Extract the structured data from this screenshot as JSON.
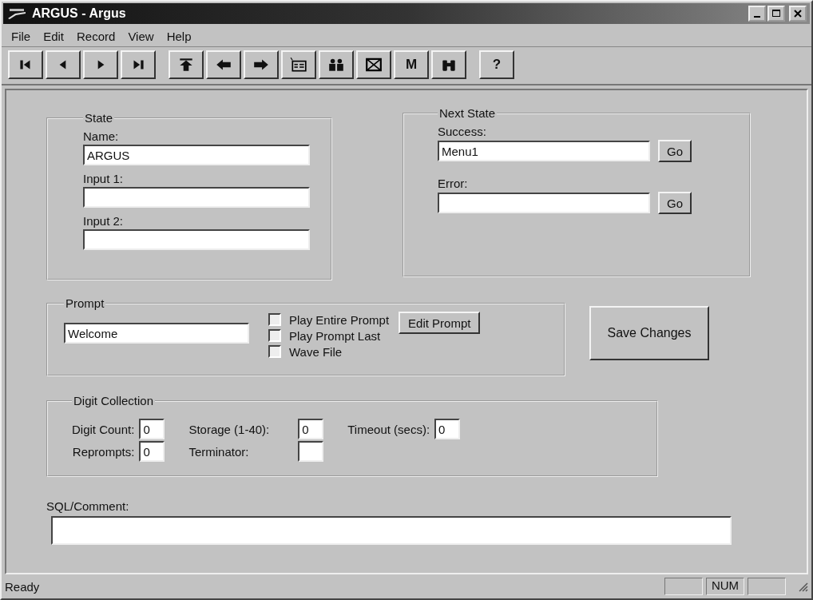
{
  "window": {
    "title": "ARGUS - Argus"
  },
  "menu": [
    "File",
    "Edit",
    "Record",
    "View",
    "Help"
  ],
  "toolbar": [
    [
      {
        "kind": "first"
      },
      {
        "kind": "prev"
      },
      {
        "kind": "next"
      },
      {
        "kind": "last"
      }
    ],
    [
      {
        "kind": "top"
      },
      {
        "kind": "left"
      },
      {
        "kind": "right"
      },
      {
        "kind": "list"
      },
      {
        "kind": "people"
      },
      {
        "kind": "cross"
      },
      {
        "kind": "letter",
        "label": "M"
      },
      {
        "kind": "binoculars"
      }
    ],
    [
      {
        "kind": "letter",
        "label": "?"
      }
    ]
  ],
  "state": {
    "title": "State",
    "fields": [
      {
        "label": "Name:",
        "value": "ARGUS"
      },
      {
        "label": "Input 1:"
      },
      {
        "label": "Input 2:"
      }
    ]
  },
  "next_state": {
    "title": "Next State",
    "fields": [
      {
        "label": "Success:",
        "value": "Menu1",
        "button": "Go"
      },
      {
        "label": "Error:",
        "button": "Go"
      }
    ]
  },
  "prompt": {
    "title": "Prompt",
    "value": "Welcome",
    "checkboxes": [
      {
        "label": "Play Entire Prompt",
        "checked": false
      },
      {
        "label": "Play Prompt Last",
        "checked": false
      },
      {
        "label": "Wave File",
        "checked": false
      }
    ],
    "button": "Edit Prompt"
  },
  "save_button": "Save Changes",
  "digit_collection": {
    "title": "Digit Collection",
    "fields": [
      {
        "label": "Digit Count:",
        "value": "0"
      },
      {
        "label": "Reprompts:",
        "value": "0"
      },
      {
        "label": "Storage (1-40):",
        "value": "0"
      },
      {
        "label": "Terminator:"
      },
      {
        "label": "Timeout (secs):",
        "value": "0"
      }
    ]
  },
  "sql": {
    "label": "SQL/Comment:"
  },
  "status_bar": {
    "text": "Ready",
    "indicator": "NUM"
  }
}
